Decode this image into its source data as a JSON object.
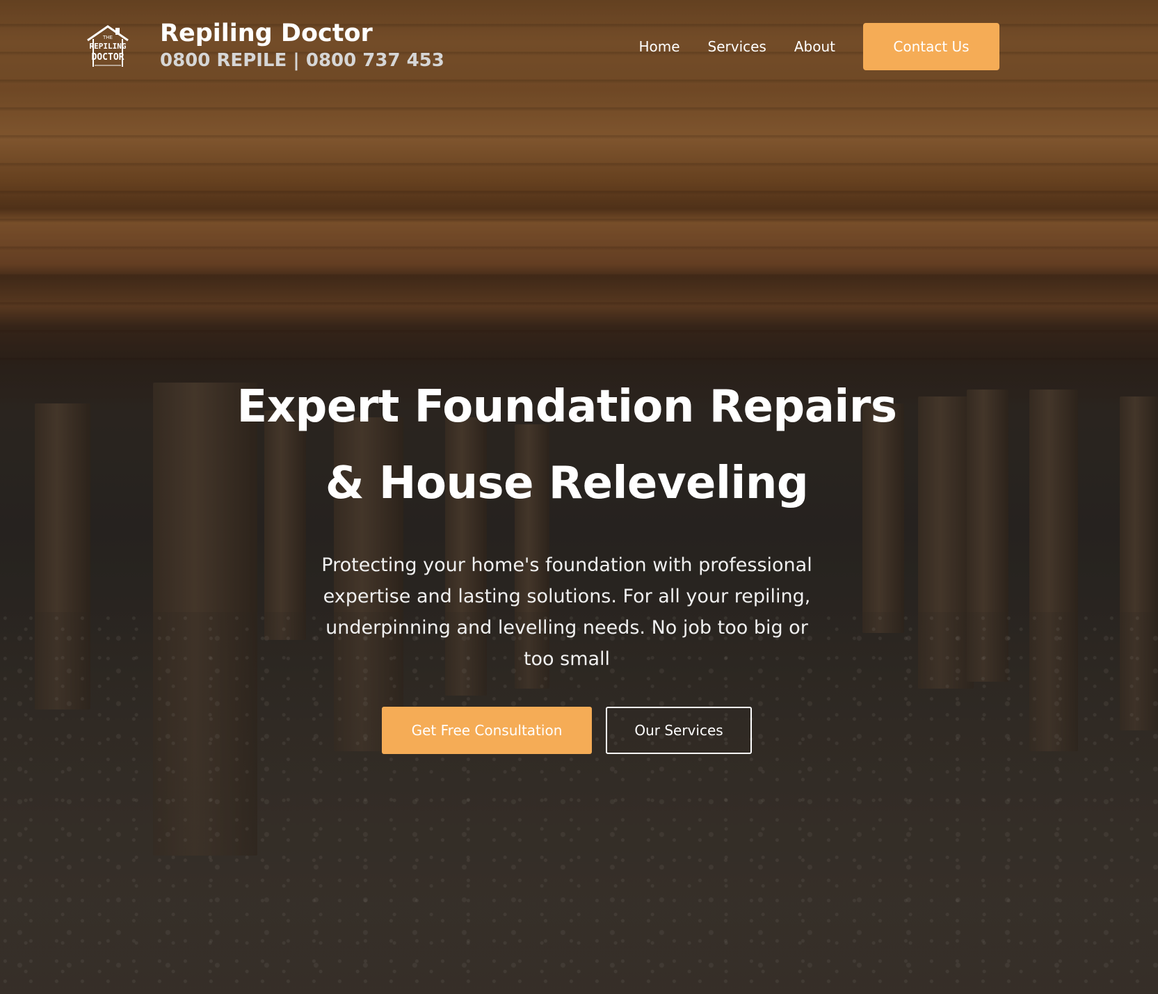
{
  "brand": {
    "logo_icon": "house-logo-icon",
    "logo_text": "THE REPILING DOCTOR",
    "name": "Repiling Doctor",
    "phone": "0800 REPILE | 0800 737 453"
  },
  "nav": {
    "items": [
      {
        "label": "Home"
      },
      {
        "label": "Services"
      },
      {
        "label": "About"
      }
    ],
    "contact_label": "Contact Us"
  },
  "hero": {
    "title_line1": "Expert Foundation Repairs",
    "title_line2": "& House Releveling",
    "subtitle": "Protecting your home's foundation with professional expertise and lasting solutions. For all your repiling, underpinning and levelling needs. No job too big or too small",
    "primary_cta": "Get Free Consultation",
    "secondary_cta": "Our Services"
  },
  "colors": {
    "accent": "#f5ac56",
    "text": "#ffffff"
  }
}
